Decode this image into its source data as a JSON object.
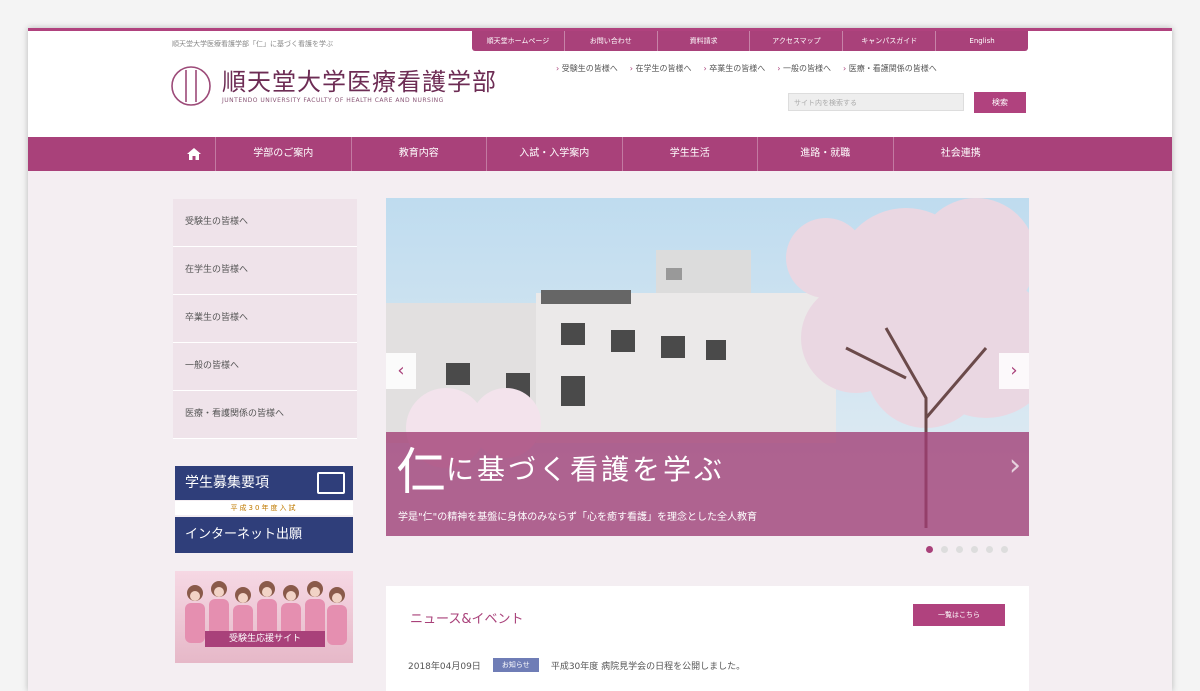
{
  "header": {
    "tagline": "順天堂大学医療看護学部「仁」に基づく看護を学ぶ",
    "util_links": [
      "順天堂ホームページ",
      "お問い合わせ",
      "資料請求",
      "アクセスマップ",
      "キャンパスガイド",
      "English"
    ],
    "logo_jp": "順天堂大学医療看護学部",
    "logo_en": "JUNTENDO UNIVERSITY FACULTY OF HEALTH CARE AND NURSING",
    "audience_links": [
      "受験生の皆様へ",
      "在学生の皆様へ",
      "卒業生の皆様へ",
      "一般の皆様へ",
      "医療・看護関係の皆様へ"
    ],
    "search_placeholder": "サイト内を検索する",
    "search_button": "検索"
  },
  "global_nav": {
    "home_icon": "home-icon",
    "items": [
      "学部のご案内",
      "教育内容",
      "入試・入学案内",
      "学生生活",
      "進路・就職",
      "社会連携"
    ]
  },
  "sidebar": {
    "items": [
      "受験生の皆様へ",
      "在学生の皆様へ",
      "卒業生の皆様へ",
      "一般の皆様へ",
      "医療・看護関係の皆様へ"
    ],
    "banner_recruit": "学生募集要項",
    "banner_recruit_sub": "平成30年度入試",
    "banner_net": "インターネット出願",
    "banner_campus": "受験生応援サイト"
  },
  "hero": {
    "headline_big": "仁",
    "headline_rest": "に基づく看護を学ぶ",
    "caption": "学是\"仁\"の精神を基盤に身体のみならず「心を癒す看護」を理念とした全人教育",
    "prev": "‹",
    "next": "›",
    "slide_count": 6,
    "active_slide": 1
  },
  "news": {
    "title": "ニュース&イベント",
    "more_label": "一覧はこちら",
    "items": [
      {
        "date": "2018年04月09日",
        "tag": "お知らせ",
        "text": "平成30年度 病院見学会の日程を公開しました。"
      }
    ]
  },
  "colors": {
    "accent": "#a9417a",
    "navy": "#2f3e7a"
  }
}
